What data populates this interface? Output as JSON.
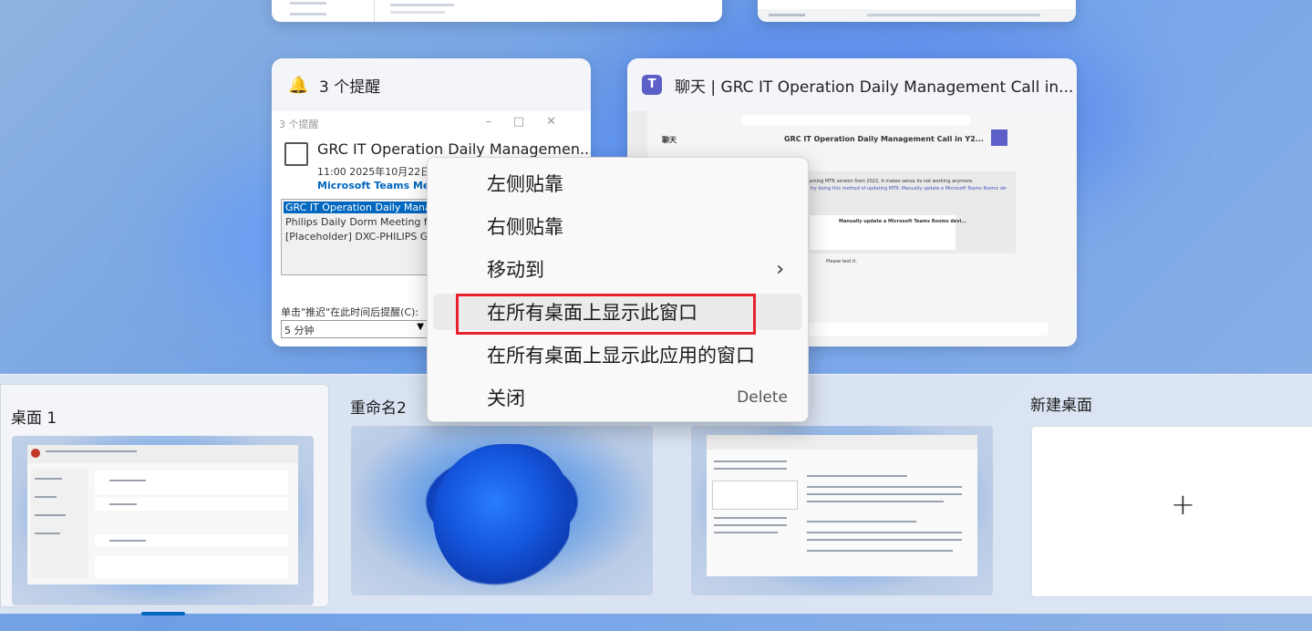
{
  "windows": {
    "reminder": {
      "title": "3 个提醒",
      "inner_title": "3 个提醒",
      "event_title": "GRC IT Operation Daily Managemen...",
      "event_time": "11:00 2025年10月22日星",
      "event_link": "Microsoft Teams Meetin",
      "list": [
        "GRC IT Operation Daily Mana",
        "Philips Daily Dorm Meeting f",
        "[Placeholder] DXC-PHILIPS G"
      ],
      "snooze_label": "单击\"推迟\"在此时间后提醒(C):",
      "snooze_value": "5 分钟"
    },
    "teams": {
      "title": "聊天 | GRC IT Operation Daily Management Call in...",
      "chat_header": "聊天",
      "meeting_title": "GRC IT Operation Daily Management Call in Y2...",
      "messages": [
        "running MTR version from 2022, it makes sense its not working anymore.",
        "n try doing this method of updating MTR: Manually update a Microsoft Teams Rooms device",
        "Manually update a Microsoft Teams Rooms devi..."
      ],
      "please_test": "Please test it."
    }
  },
  "context_menu": {
    "items": [
      {
        "label": "左侧贴靠",
        "shortcut": ""
      },
      {
        "label": "右侧贴靠",
        "shortcut": ""
      },
      {
        "label": "移动到",
        "shortcut": "›"
      },
      {
        "label": "在所有桌面上显示此窗口",
        "shortcut": ""
      },
      {
        "label": "在所有桌面上显示此应用的窗口",
        "shortcut": ""
      },
      {
        "label": "关闭",
        "shortcut": "Delete"
      }
    ],
    "highlight_color": "#e8222d"
  },
  "desktops": {
    "items": [
      {
        "label": "桌面 1"
      },
      {
        "label": "重命名2"
      },
      {
        "label": ""
      }
    ],
    "new_desktop_label": "新建桌面",
    "plus": "+"
  },
  "colors": {
    "accent": "#0067c0",
    "highlight": "#e8222d"
  }
}
